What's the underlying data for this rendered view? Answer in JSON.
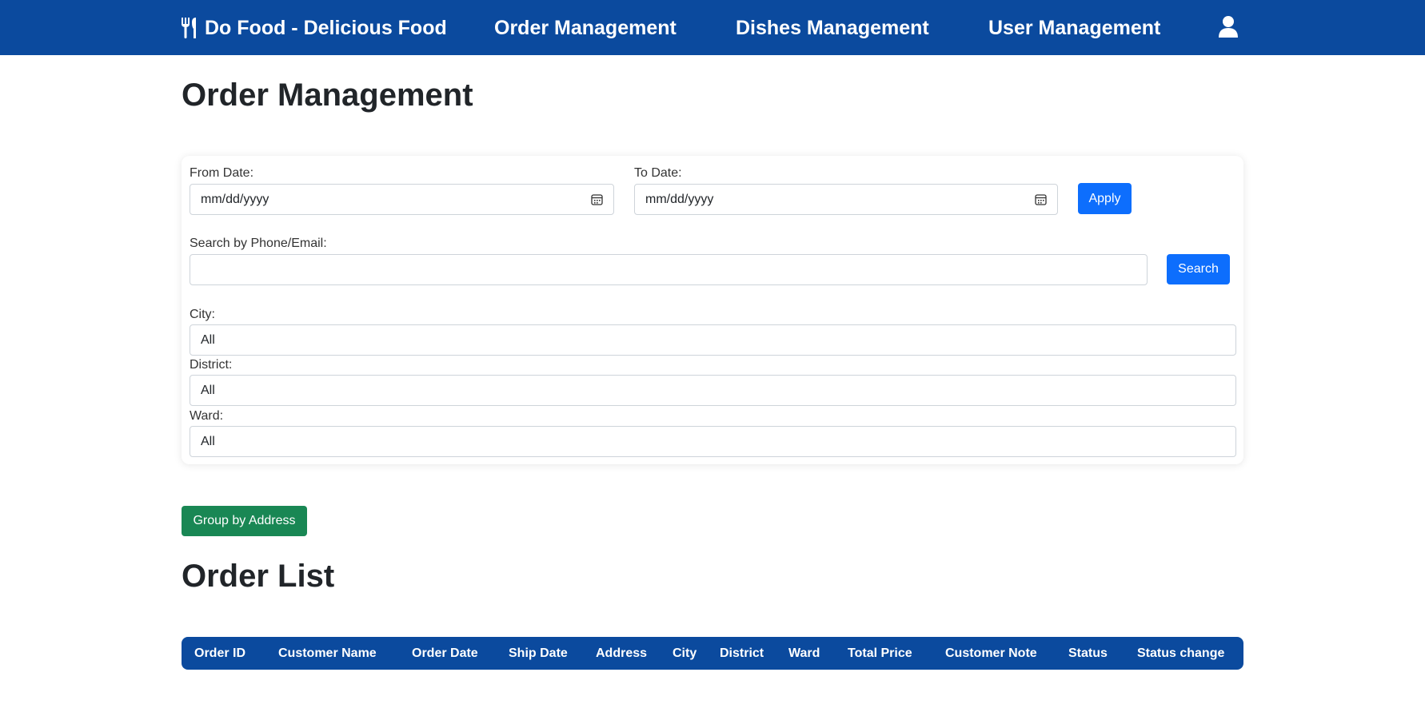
{
  "nav": {
    "brand": "Do Food - Delicious Food",
    "brand_icon": "fork-knife-icon",
    "links": [
      "Order Management",
      "Dishes Management",
      "User Management"
    ],
    "user_icon": "user-icon",
    "bg_color": "#0b4a9e"
  },
  "page": {
    "title": "Order Management"
  },
  "filters": {
    "from_label": "From Date:",
    "from_value": "mm/dd/yyyy",
    "to_label": "To Date:",
    "to_value": "mm/dd/yyyy",
    "calendar_icon": "calendar-icon",
    "apply_label": "Apply",
    "search_label": "Search by Phone/Email:",
    "search_value": "",
    "search_button": "Search",
    "city_label": "City:",
    "city_value": "All",
    "district_label": "District:",
    "district_value": "All",
    "ward_label": "Ward:",
    "ward_value": "All"
  },
  "group_button": "Group by Address",
  "order_list": {
    "title": "Order List",
    "columns": [
      "Order ID",
      "Customer Name",
      "Order Date",
      "Ship Date",
      "Address",
      "City",
      "District",
      "Ward",
      "Total Price",
      "Customer Note",
      "Status",
      "Status change"
    ]
  },
  "colors": {
    "primary": "#0d6efd",
    "success": "#198754",
    "header": "#0b4a9e"
  }
}
